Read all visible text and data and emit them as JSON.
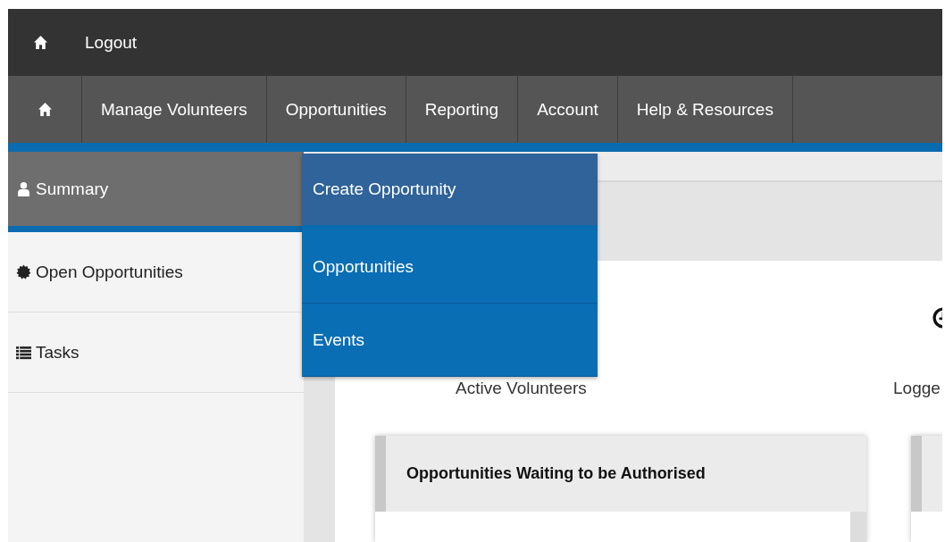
{
  "top_bar": {
    "links": [
      {
        "kind": "home"
      },
      {
        "kind": "text",
        "label": "Logout"
      }
    ]
  },
  "nav": {
    "items": [
      {
        "kind": "home"
      },
      {
        "kind": "text",
        "label": "Manage Volunteers"
      },
      {
        "kind": "text",
        "label": "Opportunities"
      },
      {
        "kind": "text",
        "label": "Reporting"
      },
      {
        "kind": "text",
        "label": "Account"
      },
      {
        "kind": "text",
        "label": "Help & Resources"
      },
      {
        "kind": "blank"
      }
    ]
  },
  "dropdown": {
    "items": [
      {
        "label": "Create Opportunity",
        "selected": true
      },
      {
        "label": "Opportunities",
        "selected": false
      },
      {
        "label": "Events",
        "selected": false
      }
    ]
  },
  "sidebar": {
    "items": [
      {
        "kind": "user",
        "label": "Summary",
        "selected": true
      },
      {
        "kind": "badge",
        "label": "Open Opportunities",
        "selected": false
      },
      {
        "kind": "list",
        "label": "Tasks",
        "selected": false
      }
    ]
  },
  "stats": [
    {
      "kind": "plain",
      "label": "Active Volunteers"
    },
    {
      "kind": "clock",
      "label": "Logge"
    }
  ],
  "cards": [
    {
      "kind": "titled",
      "title": "Opportunities Waiting to be Authorised"
    },
    {
      "kind": "blank"
    }
  ]
}
